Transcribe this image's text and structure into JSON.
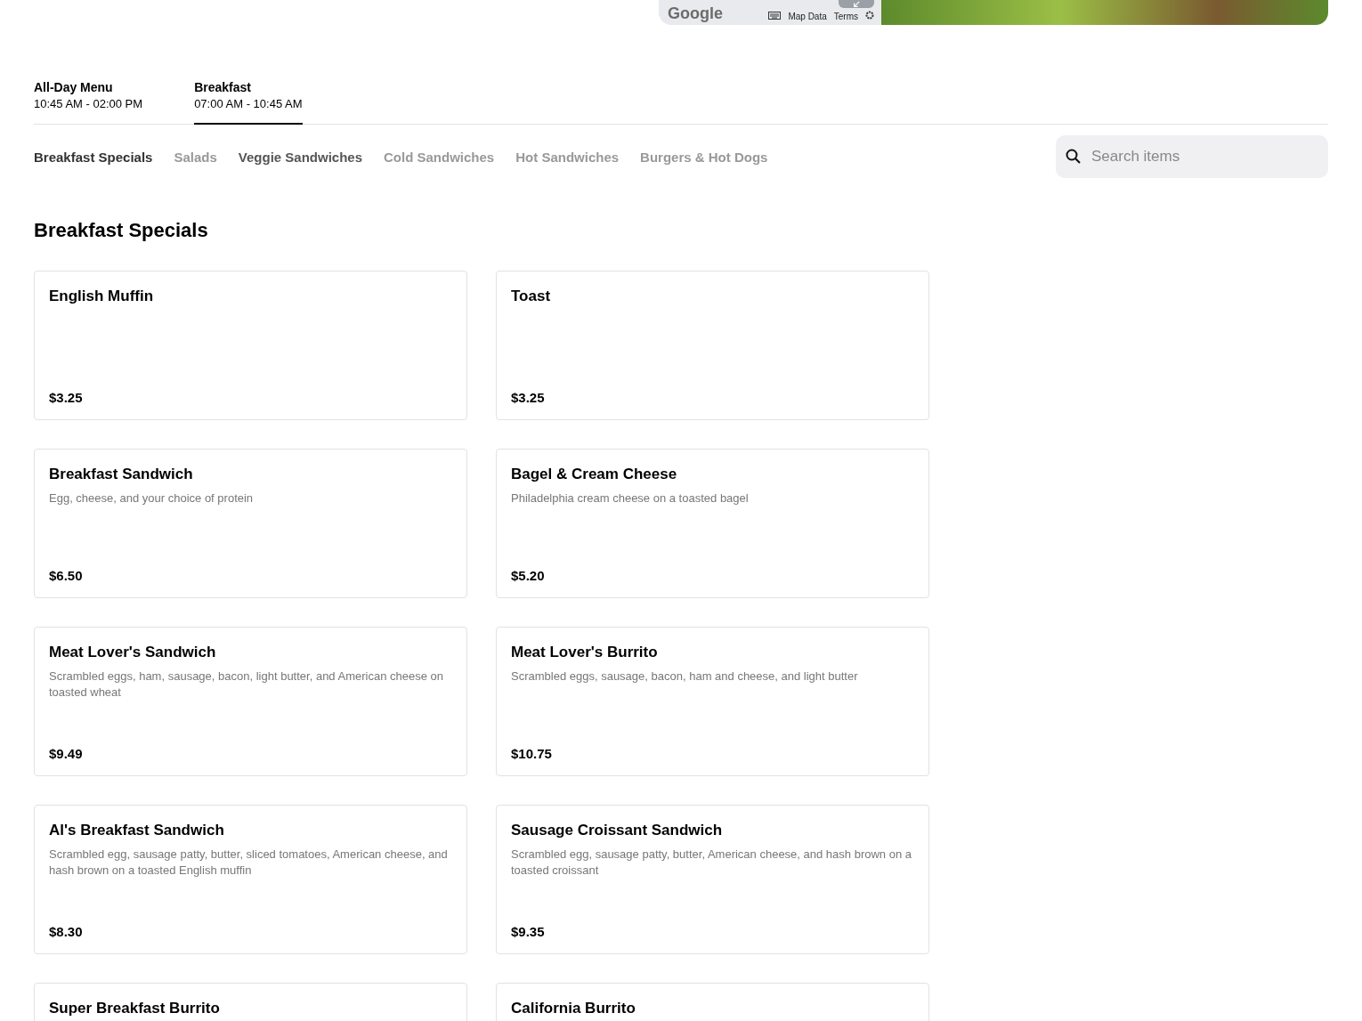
{
  "header": {
    "map": {
      "logo": "Google",
      "links": [
        "Map Data",
        "Terms"
      ]
    }
  },
  "menus": [
    {
      "name": "All-Day Menu",
      "hours": "10:45 AM - 02:00 PM",
      "selected": false
    },
    {
      "name": "Breakfast",
      "hours": "07:00 AM - 10:45 AM",
      "selected": true
    }
  ],
  "categories": [
    {
      "label": "Breakfast Specials",
      "selected": true,
      "hovered": false
    },
    {
      "label": "Salads",
      "selected": false,
      "hovered": false
    },
    {
      "label": "Veggie Sandwiches",
      "selected": false,
      "hovered": true
    },
    {
      "label": "Cold Sandwiches",
      "selected": false,
      "hovered": false
    },
    {
      "label": "Hot Sandwiches",
      "selected": false,
      "hovered": false
    },
    {
      "label": "Burgers & Hot Dogs",
      "selected": false,
      "hovered": false
    }
  ],
  "search": {
    "placeholder": "Search items"
  },
  "section": {
    "title": "Breakfast Specials",
    "items": [
      {
        "name": "English Muffin",
        "price": "$3.25"
      },
      {
        "name": "Toast",
        "price": "$3.25"
      },
      {
        "name": "Breakfast Sandwich",
        "description": "Egg, cheese, and your choice of protein",
        "price": "$6.50"
      },
      {
        "name": "Bagel & Cream Cheese",
        "description": "Philadelphia cream cheese on a toasted bagel",
        "price": "$5.20"
      },
      {
        "name": "Meat Lover's Sandwich",
        "description": "Scrambled eggs, ham, sausage, bacon, light butter, and American cheese on toasted wheat",
        "price": "$9.49"
      },
      {
        "name": "Meat Lover's Burrito",
        "description": "Scrambled eggs, sausage, bacon, ham and cheese, and light butter",
        "price": "$10.75"
      },
      {
        "name": "Al's Breakfast Sandwich",
        "description": "Scrambled egg, sausage patty, butter, sliced tomatoes, American cheese, and hash brown on a toasted English muffin",
        "price": "$8.30"
      },
      {
        "name": "Sausage Croissant Sandwich",
        "description": "Scrambled egg, sausage patty, butter, American cheese, and hash brown on a toasted croissant",
        "price": "$9.35"
      },
      {
        "name": "Super Breakfast Burrito"
      },
      {
        "name": "California Burrito"
      }
    ]
  }
}
